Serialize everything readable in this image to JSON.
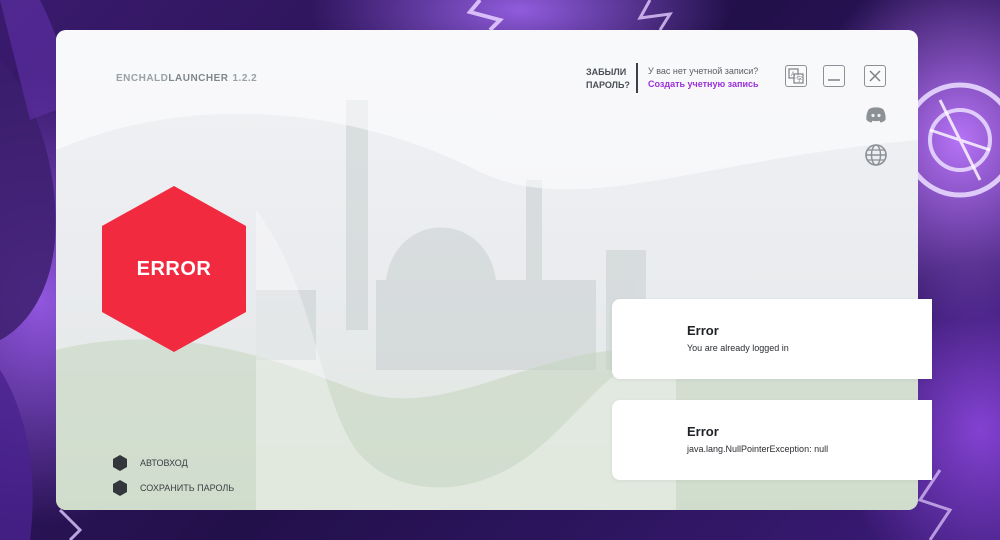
{
  "app": {
    "name_part1": "ENCHALD",
    "name_part2": "LAUNCHER",
    "version": "1.2.2"
  },
  "header": {
    "forgot_line1": "ЗАБЫЛИ",
    "forgot_line2": "ПАРОЛЬ?",
    "no_account": "У вас нет учетной записи?",
    "create_account": "Создать учетную запись"
  },
  "window_buttons": [
    {
      "icon": "translate-icon"
    },
    {
      "icon": "minimize-icon"
    },
    {
      "icon": "close-icon"
    }
  ],
  "side_icons": [
    {
      "icon": "discord-icon"
    },
    {
      "icon": "globe-icon"
    }
  ],
  "status": {
    "label": "ERROR",
    "color": "#f22a3f"
  },
  "options": [
    {
      "label": "АВТОВХОД"
    },
    {
      "label": "СОХРАНИТЬ ПАРОЛЬ"
    }
  ],
  "notifications": [
    {
      "title": "Error",
      "message": "You are already logged in"
    },
    {
      "title": "Error",
      "message": "java.lang.NullPointerException: null"
    }
  ],
  "colors": {
    "accent": "#9b30d9",
    "error": "#f22a3f",
    "background": "#2a1550"
  }
}
